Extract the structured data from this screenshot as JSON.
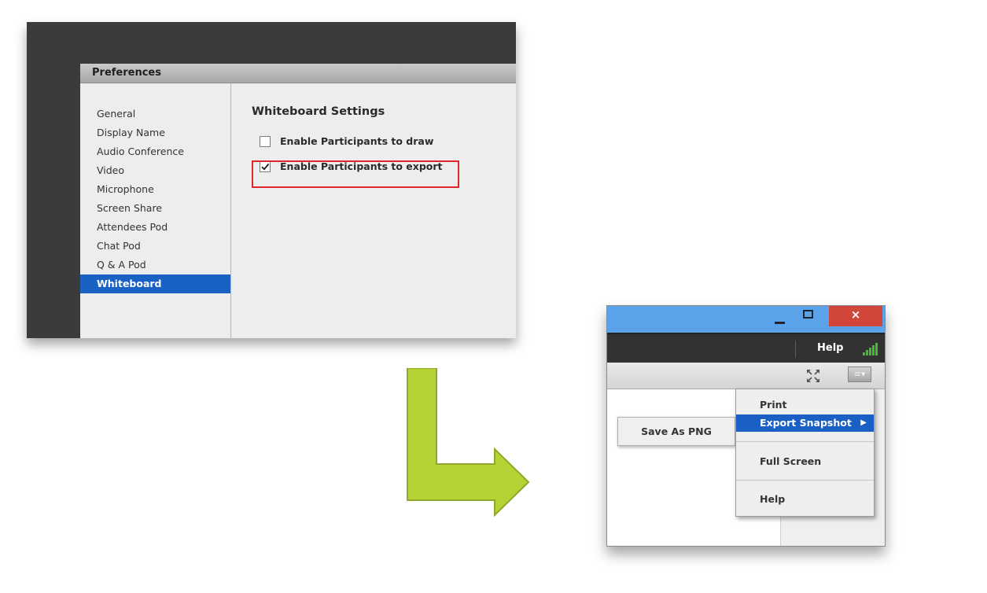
{
  "preferences": {
    "title": "Preferences",
    "sidebar": [
      {
        "label": "General",
        "selected": false
      },
      {
        "label": "Display Name",
        "selected": false
      },
      {
        "label": "Audio Conference",
        "selected": false
      },
      {
        "label": "Video",
        "selected": false
      },
      {
        "label": "Microphone",
        "selected": false
      },
      {
        "label": "Screen Share",
        "selected": false
      },
      {
        "label": "Attendees Pod",
        "selected": false
      },
      {
        "label": "Chat Pod",
        "selected": false
      },
      {
        "label": "Q & A Pod",
        "selected": false
      },
      {
        "label": "Whiteboard",
        "selected": true
      }
    ],
    "heading": "Whiteboard Settings",
    "options": [
      {
        "label": "Enable Participants to draw",
        "checked": false
      },
      {
        "label": "Enable Participants to export",
        "checked": true
      }
    ],
    "highlight_color": "#e0252b"
  },
  "arrow": {
    "color": "#b5d335",
    "icon": "arrow-down-right-icon"
  },
  "meeting_window": {
    "close_symbol": "×",
    "menubar_help": "Help",
    "menu_button_symbol": "≡▾",
    "context_menu": [
      {
        "label": "Print",
        "selected": false
      },
      {
        "label": "Export Snapshot",
        "selected": true,
        "submenu_arrow": "▶"
      },
      {
        "label": "Full Screen",
        "selected": false
      },
      {
        "label": "Help",
        "selected": false
      }
    ],
    "submenu": {
      "label": "Save As PNG"
    },
    "titlebar_color": "#5aa3e8",
    "selection_color": "#1a5fc4"
  }
}
